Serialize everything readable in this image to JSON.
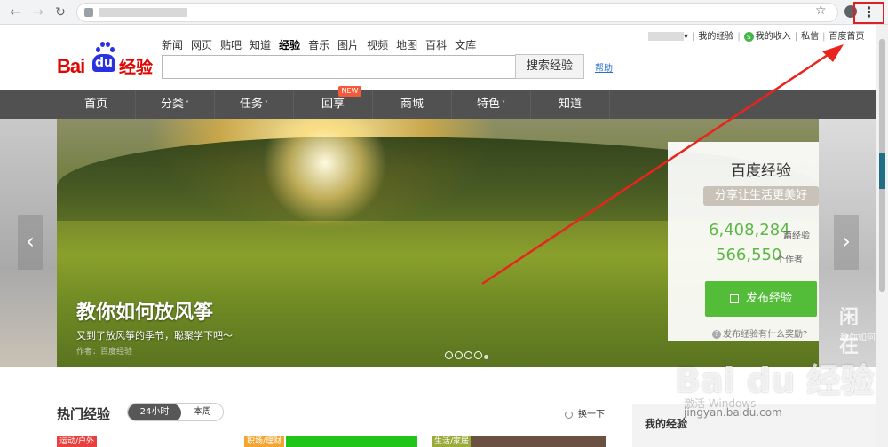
{
  "browser": {
    "back_icon": "arrow-left-icon",
    "forward_icon": "arrow-right-icon",
    "reload_icon": "reload-icon",
    "star_icon": "star-icon",
    "profile_icon": "profile-icon",
    "menu_icon": "three-dots-vertical-icon"
  },
  "header": {
    "logo_text": "Bai",
    "logo_du": "du",
    "logo_jy": "经验",
    "nav": [
      "新闻",
      "网页",
      "贴吧",
      "知道",
      "经验",
      "音乐",
      "图片",
      "视频",
      "地图",
      "百科",
      "文库"
    ],
    "search_button": "搜索经验",
    "help": "帮助"
  },
  "userbar": {
    "my_exp": "我的经验",
    "my_income": "我的收入",
    "coin_symbol": "$",
    "message": "私信",
    "baidu_home": "百度首页",
    "dropdown": "▾"
  },
  "categories": [
    {
      "label": "首页",
      "chev": ""
    },
    {
      "label": "分类",
      "chev": "˅"
    },
    {
      "label": "任务",
      "chev": "˅"
    },
    {
      "label": "回享",
      "chev": ""
    },
    {
      "label": "商城",
      "chev": ""
    },
    {
      "label": "特色",
      "chev": "˅"
    },
    {
      "label": "知道",
      "chev": ""
    }
  ],
  "new_badge": "NEW",
  "banner": {
    "title": "教你如何放风筝",
    "subtitle": "又到了放风筝的季节，聪聚学下吧～",
    "author": "作者：百度经验",
    "ghost_title": "闲在",
    "ghost_sub": "教你如何",
    "prev_glyph": "‹",
    "next_glyph": "›"
  },
  "card": {
    "title": "百度经验",
    "ribbon": "分享让生活更美好",
    "count_articles": "6,408,284",
    "unit_articles": "篇经验",
    "count_authors": "566,550",
    "unit_authors": "个作者",
    "publish": "发布经验",
    "reward": "发布经验有什么奖励?",
    "q_glyph": "?"
  },
  "hot": {
    "title": "热门经验",
    "tab_24h": "24小时",
    "tab_week": "本周",
    "refresh": "换一下",
    "tags": [
      "运动/户外",
      "职场/理财",
      "生活/家居"
    ],
    "mine_title": "我的经验"
  },
  "watermark": {
    "brand": "Bai du 经验",
    "url": "jingyan.baidu.com",
    "win": "激活 Windows"
  },
  "colors": {
    "accent_green": "#53bd3a",
    "number_green": "#5cb746",
    "brand_red": "#e10601",
    "brand_blue": "#2932e1",
    "nav_bar": "#515151"
  }
}
